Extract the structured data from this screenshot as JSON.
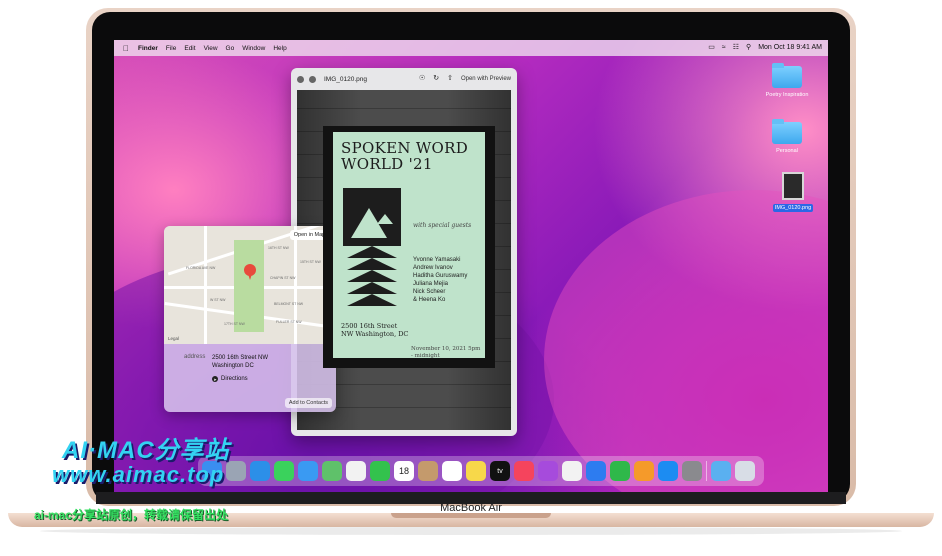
{
  "menubar": {
    "apple_icon": "apple-logo-icon",
    "items": [
      "Finder",
      "File",
      "Edit",
      "View",
      "Go",
      "Window",
      "Help"
    ],
    "status_icons": [
      "battery-icon",
      "wifi-icon",
      "control-center-icon",
      "search-icon"
    ],
    "clock": "Mon Oct 18  9:41 AM"
  },
  "desktop": {
    "items": [
      {
        "label": "Poetry Inspiration",
        "icon": "folder-icon"
      },
      {
        "label": "Personal",
        "icon": "folder-icon"
      },
      {
        "label": "IMG_0120.png",
        "icon": "image-file-icon",
        "selected": true
      }
    ]
  },
  "quicklook": {
    "title": "IMG_0120.png",
    "open_with": "Open with Preview",
    "tools": [
      "markup-icon",
      "rotate-icon",
      "share-icon"
    ]
  },
  "poster": {
    "title": "SPOKEN WORD WORLD '21",
    "with": "with special guests",
    "guests": [
      "Yvonne Yamasaki",
      "Andrew Ivanov",
      "Haditha Guruswamy",
      "Juliana Mejia",
      "Nick Scheer",
      "& Heena Ko"
    ],
    "address": "2500 16th Street NW Washington, DC",
    "date": "November 10, 2021 5pm - midnight"
  },
  "popover": {
    "open_in_maps": "Open in Maps",
    "address_label": "address",
    "address_line1": "2500 16th Street NW",
    "address_line2": "Washington DC",
    "directions": "Directions",
    "add_to_contacts": "Add to Contacts",
    "legal": "Legal",
    "streets": [
      "16TH ST NW",
      "15TH ST NW",
      "CHAPIN ST NW",
      "BELMONT ST NW",
      "FLORIDA AVE NW",
      "W ST NW",
      "17TH ST NW",
      "FULLER ST NW"
    ]
  },
  "dock": {
    "apps": [
      {
        "name": "finder",
        "color": "#3a8ef0"
      },
      {
        "name": "launchpad",
        "color": "#9aa4b4"
      },
      {
        "name": "safari",
        "color": "#2c8fe8"
      },
      {
        "name": "messages",
        "color": "#3ad25c"
      },
      {
        "name": "mail",
        "color": "#3a9af2"
      },
      {
        "name": "maps",
        "color": "#5fc16a"
      },
      {
        "name": "photos",
        "color": "#f2f2f2"
      },
      {
        "name": "facetime",
        "color": "#33c24d"
      },
      {
        "name": "calendar",
        "color": "#ffffff",
        "text": "18"
      },
      {
        "name": "contacts",
        "color": "#c49a6c"
      },
      {
        "name": "reminders",
        "color": "#ffffff"
      },
      {
        "name": "notes",
        "color": "#f7d84a"
      },
      {
        "name": "tv",
        "color": "#111111",
        "text": "tv"
      },
      {
        "name": "music",
        "color": "#f5445d"
      },
      {
        "name": "podcasts",
        "color": "#a64bdc"
      },
      {
        "name": "news",
        "color": "#f2f2f2"
      },
      {
        "name": "keynote",
        "color": "#2d7cf0"
      },
      {
        "name": "numbers",
        "color": "#2fb84a"
      },
      {
        "name": "pages",
        "color": "#f59a2a"
      },
      {
        "name": "app-store",
        "color": "#1c8cf2"
      },
      {
        "name": "system-preferences",
        "color": "#8a8a8e"
      },
      {
        "name": "downloads",
        "color": "#5ab0f0"
      },
      {
        "name": "trash",
        "color": "#d8dde6"
      }
    ]
  },
  "device": {
    "label": "MacBook Air"
  },
  "watermark": {
    "line1": "AI·MAC分享站",
    "line2": "www.aimac.top",
    "line3": "ai-mac分享站原创，转载请保留出处"
  }
}
